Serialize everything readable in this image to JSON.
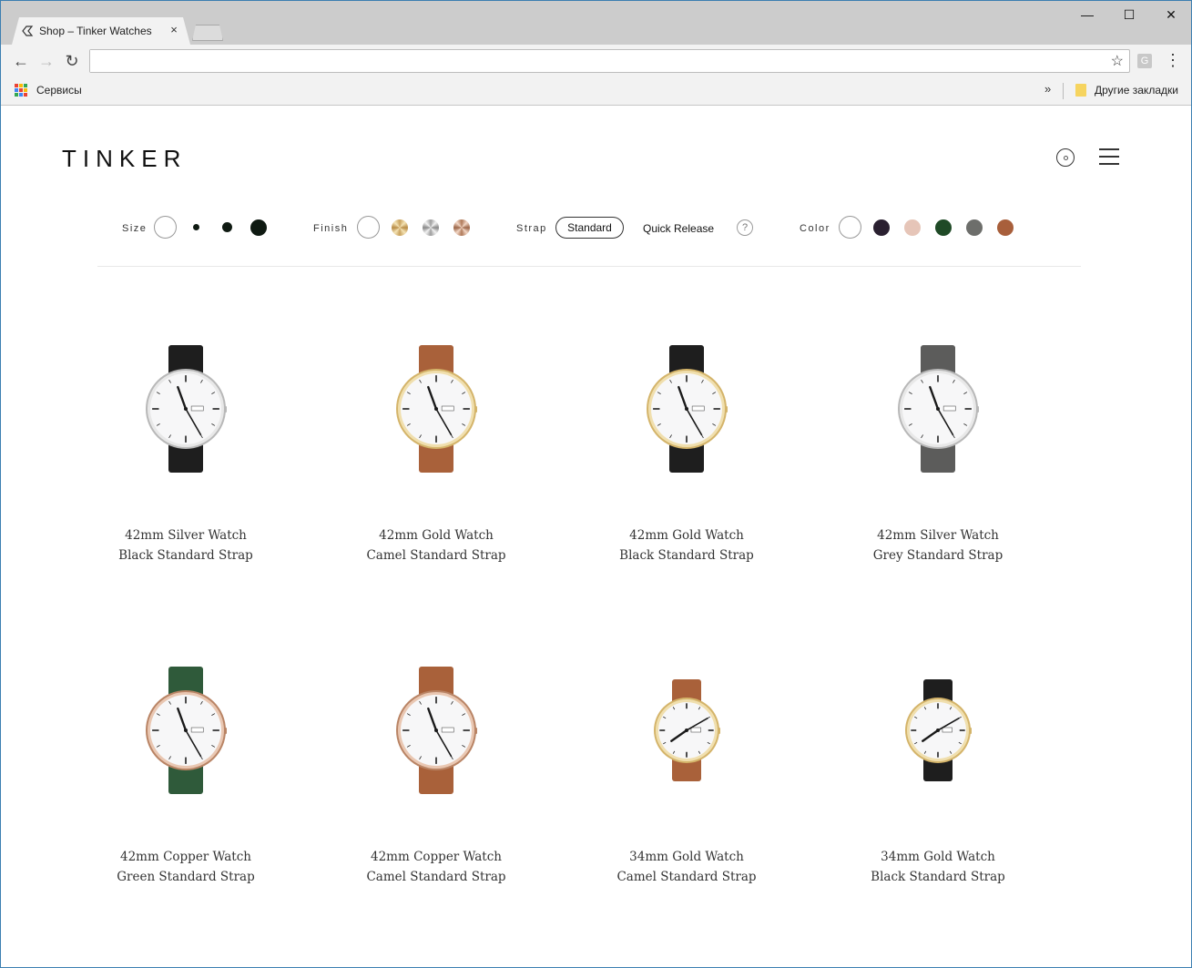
{
  "browser": {
    "tab_title": "Shop – Tinker Watches",
    "tab_close": "×",
    "address": "",
    "bookmarks_apps_label": "Сервисы",
    "bookmarks_overflow": "»",
    "other_bookmarks": "Другие закладки",
    "extension_letter": "G"
  },
  "site": {
    "logo": "TINKER"
  },
  "filters": {
    "size_label": "Size",
    "finish_label": "Finish",
    "strap_label": "Strap",
    "strap_options": [
      "Standard",
      "Quick Release"
    ],
    "strap_selected": "Standard",
    "help": "?",
    "color_label": "Color",
    "colors": [
      "#2a2030",
      "#e6c5b8",
      "#1f4a26",
      "#6d6e6b",
      "#a85f3b"
    ]
  },
  "products": [
    {
      "title": "42mm Silver Watch",
      "subtitle": "Black Standard Strap",
      "case": "silver",
      "strap": "black",
      "size": "42"
    },
    {
      "title": "42mm Gold Watch",
      "subtitle": "Camel Standard Strap",
      "case": "gold",
      "strap": "camel",
      "size": "42"
    },
    {
      "title": "42mm Gold Watch",
      "subtitle": "Black Standard Strap",
      "case": "gold",
      "strap": "black",
      "size": "42"
    },
    {
      "title": "42mm Silver Watch",
      "subtitle": "Grey Standard Strap",
      "case": "silver",
      "strap": "grey",
      "size": "42"
    },
    {
      "title": "42mm Copper Watch",
      "subtitle": "Green Standard Strap",
      "case": "copper",
      "strap": "green",
      "size": "42"
    },
    {
      "title": "42mm Copper Watch",
      "subtitle": "Camel Standard Strap",
      "case": "copper",
      "strap": "camel",
      "size": "42"
    },
    {
      "title": "34mm Gold Watch",
      "subtitle": "Camel Standard Strap",
      "case": "gold",
      "strap": "camel",
      "size": "34"
    },
    {
      "title": "34mm Gold Watch",
      "subtitle": "Black Standard Strap",
      "case": "gold",
      "strap": "black",
      "size": "34"
    }
  ]
}
